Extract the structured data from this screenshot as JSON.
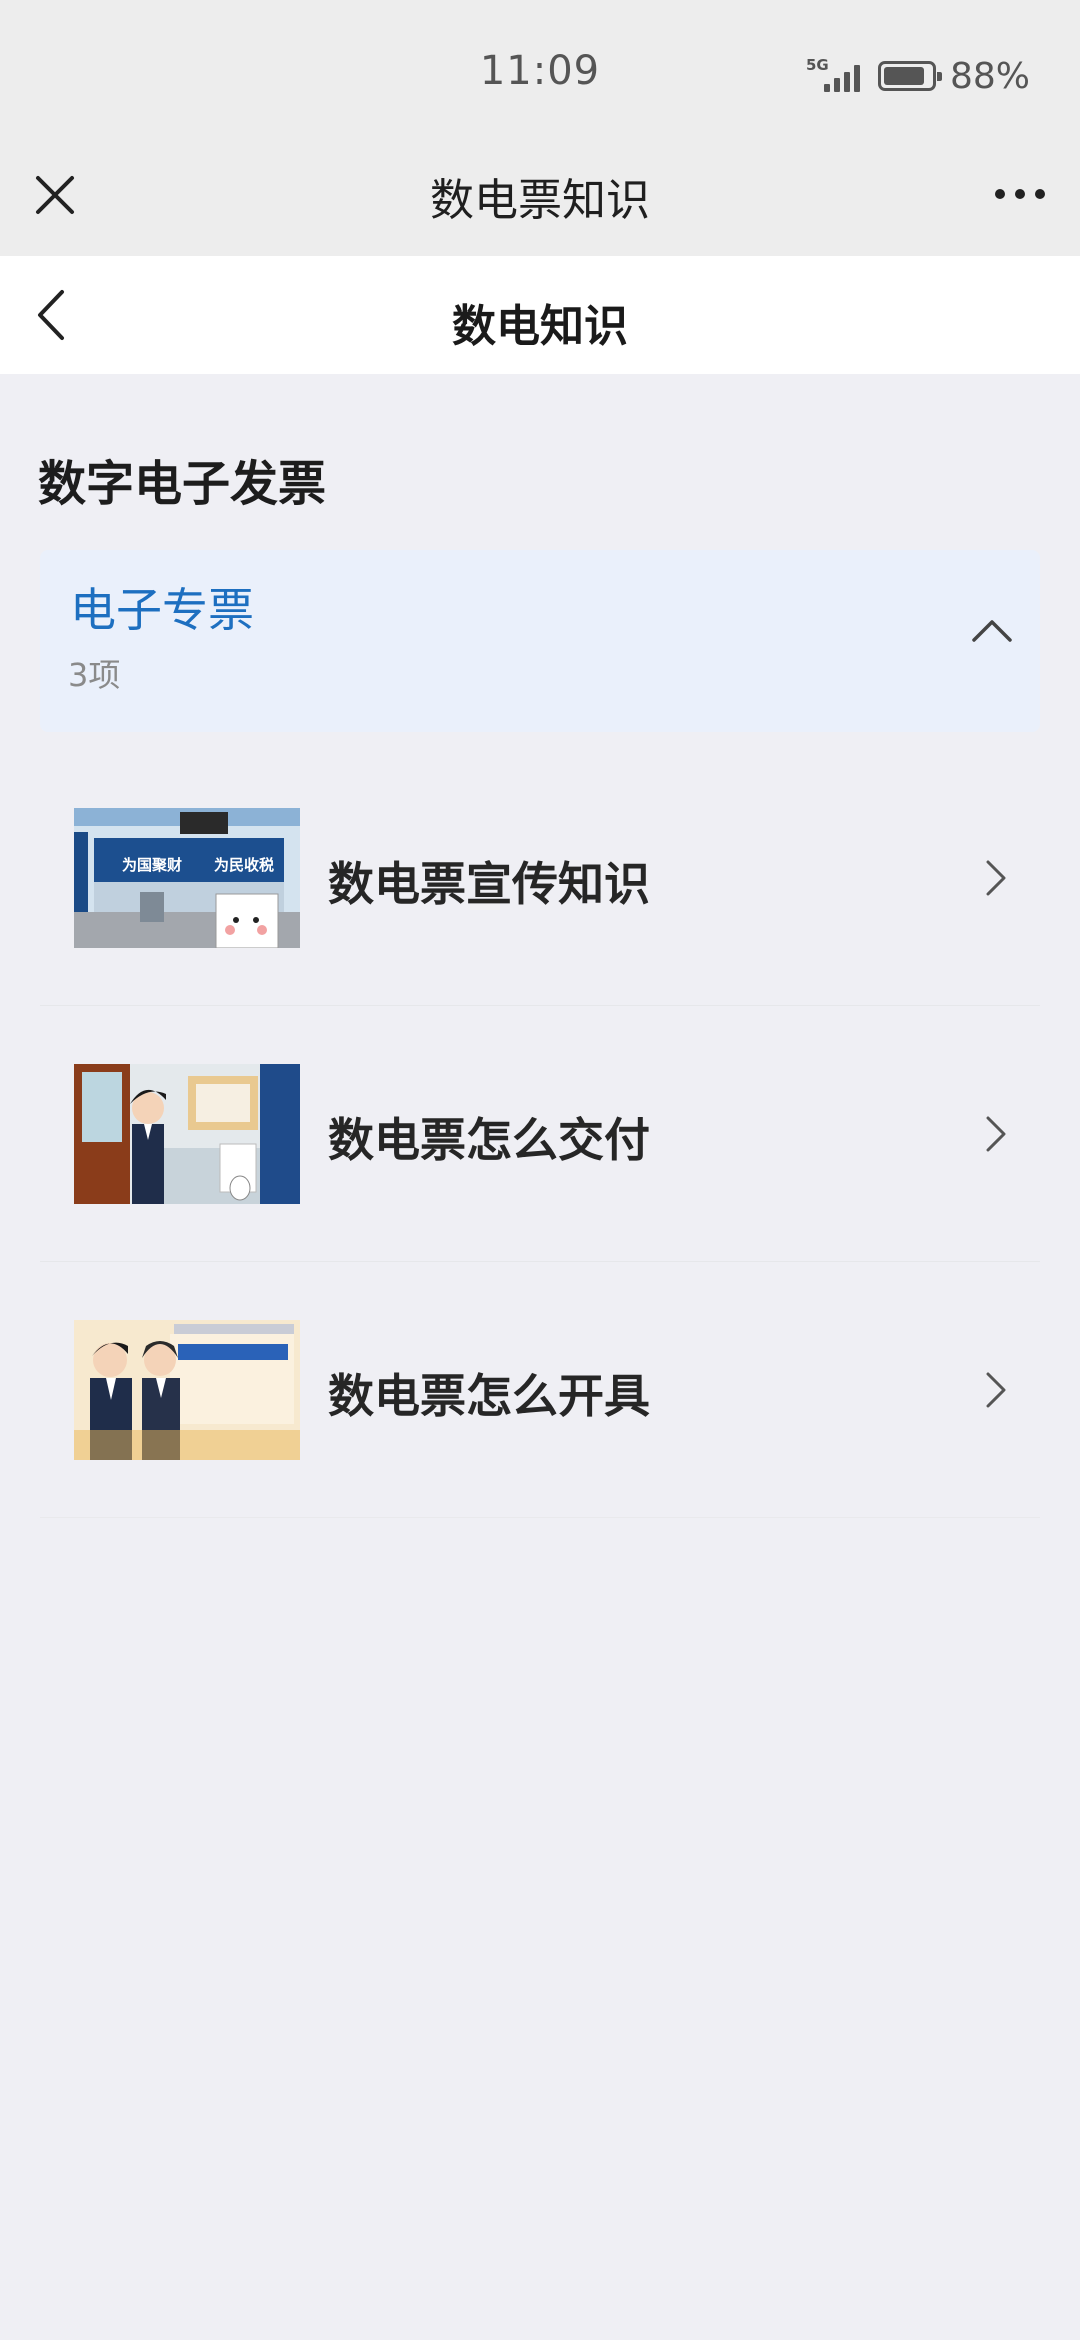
{
  "status_bar": {
    "time": "11:09",
    "network": "5G",
    "battery_percent": "88%",
    "battery_level": 0.88
  },
  "titlebar": {
    "title": "数电票知识",
    "close_icon": "close-icon",
    "more_icon": "more-dots-icon"
  },
  "navbar": {
    "title": "数电知识",
    "back_icon": "chevron-left-icon"
  },
  "section": {
    "title": "数字电子发票"
  },
  "group": {
    "name": "电子专票",
    "count": "3项",
    "toggle_icon": "chevron-up-icon",
    "expanded": true
  },
  "items": [
    {
      "title": "数电票宣传知识",
      "thumb_text_1": "为国聚财",
      "thumb_text_2": "为民收税"
    },
    {
      "title": "数电票怎么交付"
    },
    {
      "title": "数电票怎么开具"
    }
  ],
  "colors": {
    "accent": "#1d6fc0",
    "group_bg": "#eaf0fb",
    "page_bg": "#efeff4"
  }
}
